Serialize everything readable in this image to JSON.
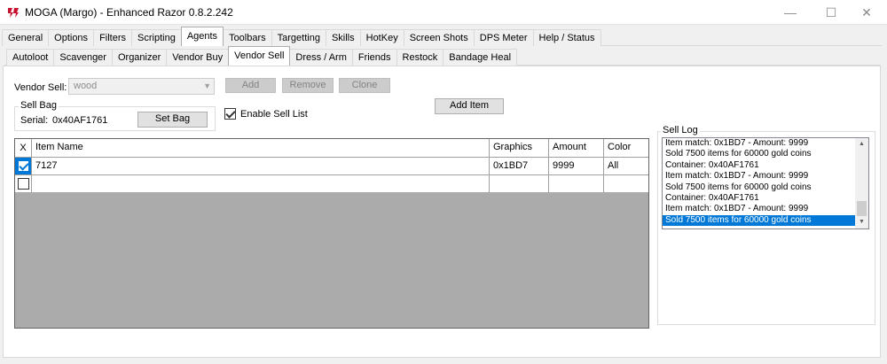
{
  "window": {
    "title": "MOGA (Margo) - Enhanced Razor 0.8.2.242",
    "controls": {
      "minimize": "—",
      "maximize": "☐",
      "close": "✕"
    }
  },
  "main_tabs": [
    {
      "label": "General"
    },
    {
      "label": "Options"
    },
    {
      "label": "Filters"
    },
    {
      "label": "Scripting"
    },
    {
      "label": "Agents"
    },
    {
      "label": "Toolbars"
    },
    {
      "label": "Targetting"
    },
    {
      "label": "Skills"
    },
    {
      "label": "HotKey"
    },
    {
      "label": "Screen Shots"
    },
    {
      "label": "DPS Meter"
    },
    {
      "label": "Help / Status"
    }
  ],
  "main_tabs_active": "Agents",
  "sub_tabs": [
    {
      "label": "Autoloot"
    },
    {
      "label": "Scavenger"
    },
    {
      "label": "Organizer"
    },
    {
      "label": "Vendor Buy"
    },
    {
      "label": "Vendor Sell"
    },
    {
      "label": "Dress / Arm"
    },
    {
      "label": "Friends"
    },
    {
      "label": "Restock"
    },
    {
      "label": "Bandage Heal"
    }
  ],
  "sub_tabs_active": "Vendor Sell",
  "vendor_sell": {
    "label": "Vendor Sell:",
    "selected_value": "wood",
    "add_button": "Add",
    "remove_button": "Remove",
    "clone_button": "Clone",
    "add_item_button": "Add Item",
    "enable_sell_list_label": "Enable Sell List",
    "enable_sell_list_checked": true
  },
  "sell_bag": {
    "title": "Sell Bag",
    "serial_label": "Serial:",
    "serial_value": "0x40AF1761",
    "set_bag_button": "Set Bag"
  },
  "item_grid": {
    "columns": {
      "x": "X",
      "name": "Item Name",
      "graphics": "Graphics",
      "amount": "Amount",
      "color": "Color"
    },
    "rows": [
      {
        "checked": true,
        "name": "7127",
        "graphics": "0x1BD7",
        "amount": "9999",
        "color": "All"
      },
      {
        "checked": false,
        "name": "",
        "graphics": "",
        "amount": "",
        "color": ""
      }
    ]
  },
  "sell_log": {
    "title": "Sell Log",
    "entries": [
      "Item match: 0x1BD7 - Amount: 9999",
      "Sold 7500 items for 60000 gold coins",
      "Container: 0x40AF1761",
      "Item match: 0x1BD7 - Amount: 9999",
      "Sold 7500 items for 60000 gold coins",
      "Container: 0x40AF1761",
      "Item match: 0x1BD7 - Amount: 9999",
      "Sold 7500 items for 60000 gold coins"
    ],
    "selected_index": 7
  },
  "colors": {
    "selection": "#0078d7",
    "grid_background": "#ababab"
  }
}
